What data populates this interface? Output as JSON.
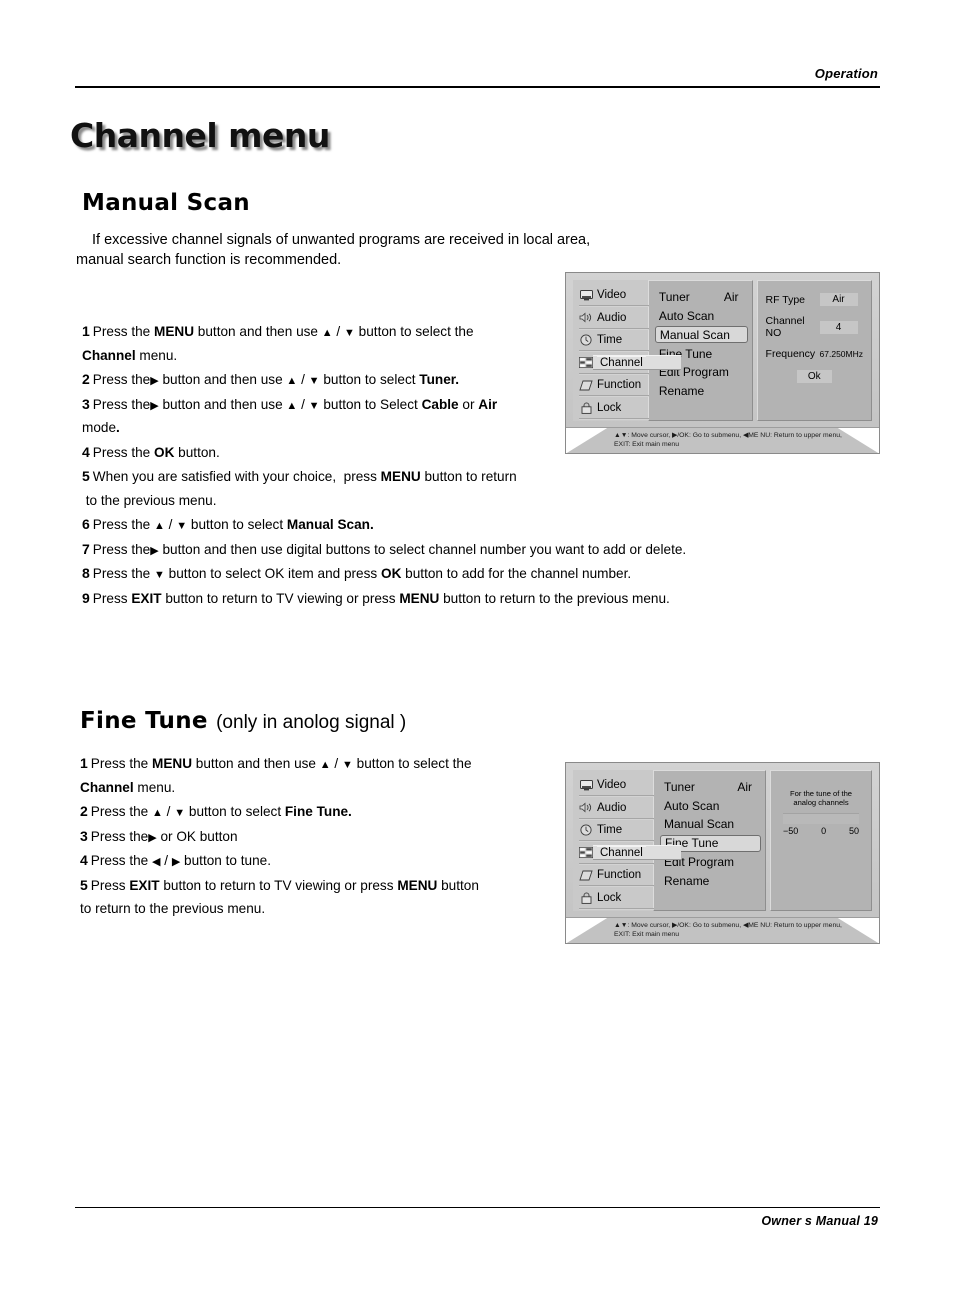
{
  "header": {
    "section": "Operation"
  },
  "page_title": "Channel menu",
  "manual_scan": {
    "heading": "Manual Scan",
    "intro_line1": "If excessive channel signals of unwanted programs are received in local area,",
    "intro_line2": "manual search function is recommended.",
    "steps": [
      {
        "num": "1",
        "text_html": "Press the <b>MENU</b> button and then use <span class=\"tri\">▲</span> / <span class=\"tri\">▼</span> button to select the<br><b>Channel</b> menu."
      },
      {
        "num": "2",
        "text_html": "Press the<span class=\"tri\">▶</span> button and then use <span class=\"tri\">▲</span> / <span class=\"tri\">▼</span> button to select <b>Tuner.</b>"
      },
      {
        "num": "3",
        "text_html": "Press the<span class=\"tri\">▶</span> button and then use <span class=\"tri\">▲</span> / <span class=\"tri\">▼</span> button to Select <b>Cable</b> or <b>Air</b><br>mode<b>.</b>"
      },
      {
        "num": "4",
        "text_html": "Press the <b>OK</b> button."
      },
      {
        "num": "5",
        "text_html": "When you are satisfied with your choice,&nbsp; press <b>MENU</b> button to return<br>&nbsp;to the previous menu."
      },
      {
        "num": "6",
        "text_html": "Press the <span class=\"tri\">▲</span> / <span class=\"tri\">▼</span> button to select <b>Manual Scan.</b>"
      },
      {
        "num": "7",
        "text_html": "Press the<span class=\"tri\">▶</span> button and then use digital buttons to select channel number you want to add or delete."
      },
      {
        "num": "8",
        "text_html": "Press the <span class=\"tri\">▼</span> button to select OK item and press <b>OK</b> button to add for the channel number."
      },
      {
        "num": "9",
        "text_html": "Press <b>EXIT</b> button to return to TV viewing or press <b>MENU</b> button to return to the previous menu."
      }
    ]
  },
  "fine_tune": {
    "heading": "Fine Tune",
    "heading_sub": "(only in anolog signal )",
    "steps": [
      {
        "num": "1",
        "text_html": "Press the <b>MENU</b> button and then use <span class=\"tri\">▲</span> / <span class=\"tri\">▼</span> button to select the<br><b>Channel</b> menu."
      },
      {
        "num": "2",
        "text_html": "Press the <span class=\"tri\">▲</span> / <span class=\"tri\">▼</span> button to select <b>Fine Tune.</b>"
      },
      {
        "num": "3",
        "text_html": "Press the<span class=\"tri\">▶</span> or OK button"
      },
      {
        "num": "4",
        "text_html": "Press the <span class=\"tri\">◀</span> / <span class=\"tri\">▶</span> button to tune."
      },
      {
        "num": "5",
        "text_html": "Press <b>EXIT</b> button to return to TV viewing or press <b>MENU</b> button<br>to return to the previous menu."
      }
    ]
  },
  "osd": {
    "sidebar": [
      {
        "label": "Video",
        "icon": "monitor-icon",
        "active": false
      },
      {
        "label": "Audio",
        "icon": "speaker-note-icon",
        "active": false
      },
      {
        "label": "Time",
        "icon": "clock-icon",
        "active": false
      },
      {
        "label": "Channel",
        "icon": "channel-grid-icon",
        "active": true
      },
      {
        "label": "Function",
        "icon": "diamond-icon",
        "active": false
      },
      {
        "label": "Lock",
        "icon": "lock-icon",
        "active": false
      }
    ],
    "menu_items": [
      {
        "label": "Tuner",
        "value": "Air"
      },
      {
        "label": "Auto Scan",
        "value": ""
      },
      {
        "label": "Manual Scan",
        "value": ""
      },
      {
        "label": "Fine Tune",
        "value": ""
      },
      {
        "label": "Edit Program",
        "value": ""
      },
      {
        "label": "Rename",
        "value": ""
      }
    ],
    "help_line1": "▲▼: Move cursor,  ▶/OK: Go to submenu,  ◀ME NU: Return to upper menu,",
    "help_line2": "EXIT: Exit main menu"
  },
  "osd_manual": {
    "selected": "Manual Scan",
    "panel": {
      "rf_type_label": "RF  Type",
      "rf_type_value": "Air",
      "channel_no_label": "Channel NO",
      "channel_no_value": "4",
      "frequency_label": "Frequency",
      "frequency_value": "67.250MHz",
      "ok_label": "Ok"
    }
  },
  "osd_fine": {
    "selected": "Fine Tune",
    "panel": {
      "caption": "For the tune of the analog channels",
      "scale_min": "−50",
      "scale_mid": "0",
      "scale_max": "50"
    }
  },
  "footer": {
    "text": "Owner s Manual   19"
  }
}
